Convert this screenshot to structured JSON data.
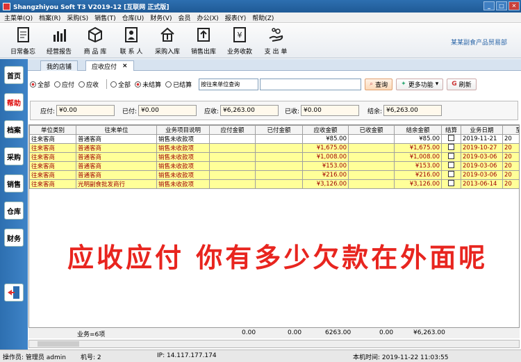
{
  "window": {
    "title": "Shangzhiyou Soft T3 V2019-12 [互联网 正式版]"
  },
  "menu": [
    "主菜单(Q)",
    "档案(R)",
    "采购(S)",
    "销售(T)",
    "仓库(U)",
    "财务(V)",
    "会员",
    "办公(X)",
    "报表(Y)",
    "帮助(Z)"
  ],
  "toolbar": {
    "items": [
      {
        "label": "日常备忘",
        "icon": "notebook-icon"
      },
      {
        "label": "经营报告",
        "icon": "bar-chart-icon"
      },
      {
        "label": "商 品 库",
        "icon": "box-icon"
      },
      {
        "label": "联 系 人",
        "icon": "contacts-icon"
      },
      {
        "label": "采购入库",
        "icon": "house-download-icon"
      },
      {
        "label": "销售出库",
        "icon": "upload-icon"
      },
      {
        "label": "业务收款",
        "icon": "yen-document-icon"
      },
      {
        "label": "支 出 单",
        "icon": "hand-coins-icon"
      }
    ],
    "company": "某某副食产品贸易部"
  },
  "leftnav": [
    "首页",
    "帮助",
    "档案",
    "采购",
    "销售",
    "仓库",
    "财务"
  ],
  "tabs": [
    {
      "label": "我的店铺"
    },
    {
      "label": "应收应付",
      "close": "×"
    }
  ],
  "filters": {
    "group1": [
      "全部",
      "应付",
      "应收"
    ],
    "group2": [
      "全部",
      "未结算",
      "已结算"
    ],
    "select_value": "按往来单位查询",
    "search_value": "",
    "query_label": "查询",
    "more_label": "更多功能",
    "refresh_label": "刷新"
  },
  "summary": {
    "ap_label": "应付:",
    "ap_value": "¥0.00",
    "paid_label": "已付:",
    "paid_value": "¥0.00",
    "ar_label": "应收:",
    "ar_value": "¥6,263.00",
    "recv_label": "已收:",
    "recv_value": "¥0.00",
    "bal_label": "结余:",
    "bal_value": "¥6,263.00"
  },
  "table": {
    "columns": [
      "单位类别",
      "往来单位",
      "业务项目说明",
      "应付金额",
      "已付金额",
      "应收金额",
      "已收金额",
      "结余金额",
      "结算",
      "业务日期",
      "至"
    ],
    "rows": [
      [
        "往来客商",
        "普通客商",
        "销售未收款项",
        "",
        "",
        "¥85.00",
        "",
        "¥85.00",
        "",
        "2019-11-21",
        "20"
      ],
      [
        "往来客商",
        "普通客商",
        "销售未收款项",
        "",
        "",
        "¥1,675.00",
        "",
        "¥1,675.00",
        "",
        "2019-10-27",
        "20"
      ],
      [
        "往来客商",
        "普通客商",
        "销售未收款项",
        "",
        "",
        "¥1,008.00",
        "",
        "¥1,008.00",
        "",
        "2019-03-06",
        "20"
      ],
      [
        "往来客商",
        "普通客商",
        "销售未收款项",
        "",
        "",
        "¥153.00",
        "",
        "¥153.00",
        "",
        "2019-03-06",
        "20"
      ],
      [
        "往来客商",
        "普通客商",
        "销售未收款项",
        "",
        "",
        "¥216.00",
        "",
        "¥216.00",
        "",
        "2019-03-06",
        "20"
      ],
      [
        "往来客商",
        "光明副食批发商行",
        "销售未收款项",
        "",
        "",
        "¥3,126.00",
        "",
        "¥3,126.00",
        "",
        "2013-06-14",
        "20"
      ]
    ],
    "footer": {
      "count": "业务=6项",
      "ap": "0.00",
      "paid": "0.00",
      "ar": "6263.00",
      "recv": "0.00",
      "bal": "¥6,263.00"
    }
  },
  "overlay_text": "应收应付 你有多少欠款在外面呢",
  "status": {
    "operator": "操作员: 管理员 admin",
    "machine": "机号: 2",
    "ip": "IP: 14.117.177.174",
    "time": "本机时间: 2019-11-22 11:03:55"
  }
}
